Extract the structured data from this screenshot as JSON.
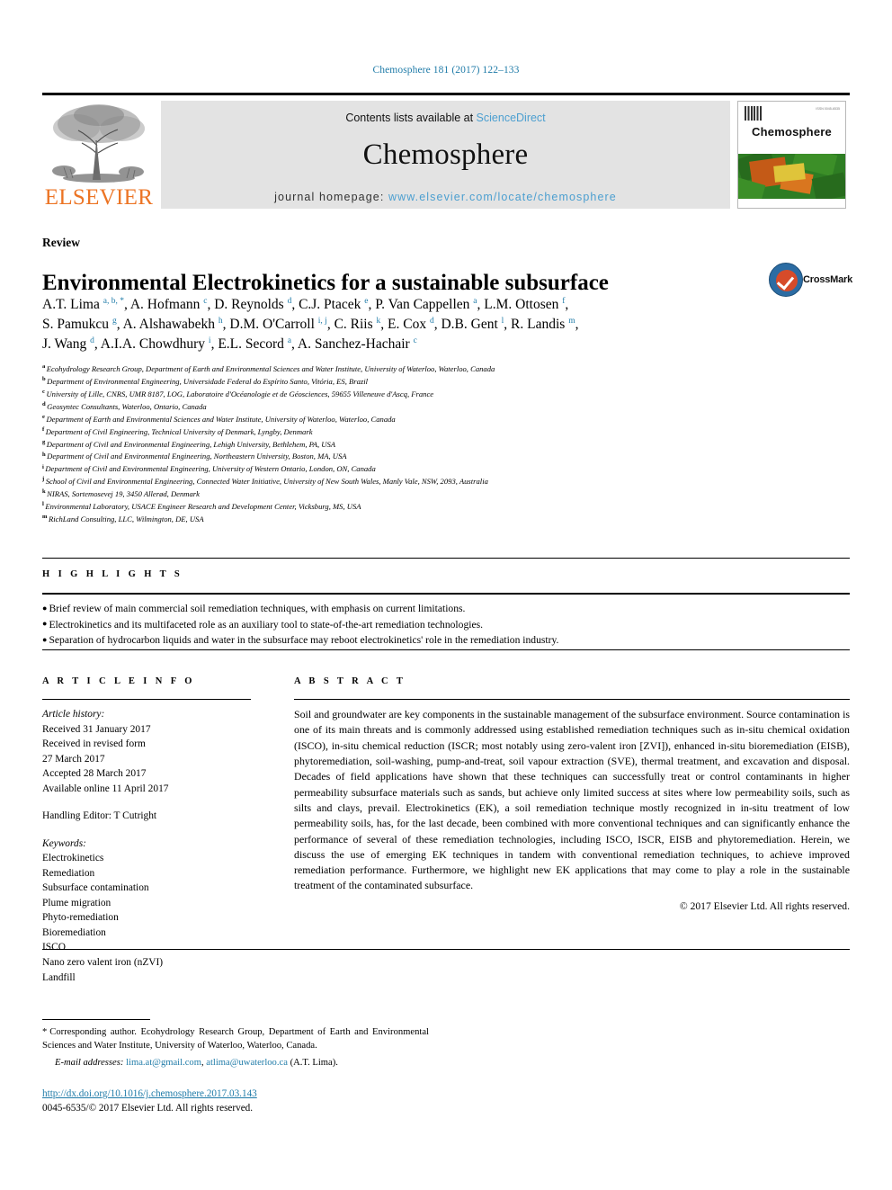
{
  "running_head": "Chemosphere 181 (2017) 122–133",
  "masthead": {
    "contents_prefix": "Contents lists available at ",
    "sciencedirect": "ScienceDirect",
    "journal_name": "Chemosphere",
    "homepage_prefix": "journal homepage: ",
    "homepage_url": "www.elsevier.com/locate/chemosphere",
    "publisher": "ELSEVIER",
    "cover_title": "Chemosphere",
    "cover_tiny_text": "ISSN 0045-6535"
  },
  "article": {
    "type": "Review",
    "title": "Environmental Electrokinetics for a sustainable subsurface",
    "crossmark_label": "CrossMark"
  },
  "authors_lines": [
    "A.T. Lima <sup>a, b, *</sup>, A. Hofmann <sup>c</sup>, D. Reynolds <sup>d</sup>, C.J. Ptacek <sup>e</sup>, P. Van Cappellen <sup>a</sup>, L.M. Ottosen <sup>f</sup>,",
    "S. Pamukcu <sup>g</sup>, A. Alshawabekh <sup>h</sup>, D.M. O'Carroll <sup>i, j</sup>, C. Riis <sup>k</sup>, E. Cox <sup>d</sup>, D.B. Gent <sup>l</sup>, R. Landis <sup>m</sup>,",
    "J. Wang <sup>d</sup>, A.I.A. Chowdhury <sup>i</sup>, E.L. Secord <sup>a</sup>, A. Sanchez-Hachair <sup>c</sup>"
  ],
  "affiliations": [
    {
      "mark": "a",
      "text": "Ecohydrology Research Group, Department of Earth and Environmental Sciences and Water Institute, University of Waterloo, Waterloo, Canada"
    },
    {
      "mark": "b",
      "text": "Department of Environmental Engineering, Universidade Federal do Espírito Santo, Vitória, ES, Brazil"
    },
    {
      "mark": "c",
      "text": "University of Lille, CNRS, UMR 8187, LOG, Laboratoire d'Océanologie et de Géosciences, 59655 Villeneuve d'Ascq, France"
    },
    {
      "mark": "d",
      "text": "Geosyntec Consultants, Waterloo, Ontario, Canada"
    },
    {
      "mark": "e",
      "text": "Department of Earth and Environmental Sciences and Water Institute, University of Waterloo, Waterloo, Canada"
    },
    {
      "mark": "f",
      "text": "Department of Civil Engineering, Technical University of Denmark, Lyngby, Denmark"
    },
    {
      "mark": "g",
      "text": "Department of Civil and Environmental Engineering, Lehigh University, Bethlehem, PA, USA"
    },
    {
      "mark": "h",
      "text": "Department of Civil and Environmental Engineering, Northeastern University, Boston, MA, USA"
    },
    {
      "mark": "i",
      "text": "Department of Civil and Environmental Engineering, University of Western Ontario, London, ON, Canada"
    },
    {
      "mark": "j",
      "text": "School of Civil and Environmental Engineering, Connected Water Initiative, University of New South Wales, Manly Vale, NSW, 2093, Australia"
    },
    {
      "mark": "k",
      "text": "NIRAS, Sortemosevej 19, 3450 Allerød, Denmark"
    },
    {
      "mark": "l",
      "text": "Environmental Laboratory, USACE Engineer Research and Development Center, Vicksburg, MS, USA"
    },
    {
      "mark": "m",
      "text": "RichLand Consulting, LLC, Wilmington, DE, USA"
    }
  ],
  "highlights": {
    "heading": "H I G H L I G H T S",
    "items": [
      "Brief review of main commercial soil remediation techniques, with emphasis on current limitations.",
      "Electrokinetics and its multifaceted role as an auxiliary tool to state-of-the-art remediation technologies.",
      "Separation of hydrocarbon liquids and water in the subsurface may reboot electrokinetics' role in the remediation industry."
    ]
  },
  "article_info": {
    "heading": "A R T I C L E  I N F O",
    "history_label": "Article history:",
    "history": [
      "Received 31 January 2017",
      "Received in revised form",
      "27 March 2017",
      "Accepted 28 March 2017",
      "Available online 11 April 2017"
    ],
    "handling_editor": "Handling Editor: T Cutright",
    "keywords_label": "Keywords:",
    "keywords": [
      "Electrokinetics",
      "Remediation",
      "Subsurface contamination",
      "Plume migration",
      "Phyto-remediation",
      "Bioremediation",
      "ISCO",
      "Nano zero valent iron (nZVI)",
      "Landfill"
    ]
  },
  "abstract": {
    "heading": "A B S T R A C T",
    "body": "Soil and groundwater are key components in the sustainable management of the subsurface environment. Source contamination is one of its main threats and is commonly addressed using established remediation techniques such as in-situ chemical oxidation (ISCO), in-situ chemical reduction (ISCR; most notably using zero-valent iron [ZVI]), enhanced in-situ bioremediation (EISB), phytoremediation, soil-washing, pump-and-treat, soil vapour extraction (SVE), thermal treatment, and excavation and disposal. Decades of field applications have shown that these techniques can successfully treat or control contaminants in higher permeability subsurface materials such as sands, but achieve only limited success at sites where low permeability soils, such as silts and clays, prevail. Electrokinetics (EK), a soil remediation technique mostly recognized in in-situ treatment of low permeability soils, has, for the last decade, been combined with more conventional techniques and can significantly enhance the performance of several of these remediation technologies, including ISCO, ISCR, EISB and phytoremediation. Herein, we discuss the use of emerging EK techniques in tandem with conventional remediation techniques, to achieve improved remediation performance. Furthermore, we highlight new EK applications that may come to play a role in the sustainable treatment of the contaminated subsurface.",
    "copyright": "© 2017 Elsevier Ltd. All rights reserved."
  },
  "footnotes": {
    "corresponding": "Corresponding author. Ecohydrology Research Group, Department of Earth and Environmental Sciences and Water Institute, University of Waterloo, Waterloo, Canada.",
    "email_label": "E-mail addresses:",
    "email_1": "lima.at@gmail.com",
    "email_2": "atlima@uwaterloo.ca",
    "email_attrib": "(A.T. Lima)."
  },
  "footer": {
    "doi": "http://dx.doi.org/10.1016/j.chemosphere.2017.03.143",
    "issn_line": "0045-6535/© 2017 Elsevier Ltd. All rights reserved."
  }
}
